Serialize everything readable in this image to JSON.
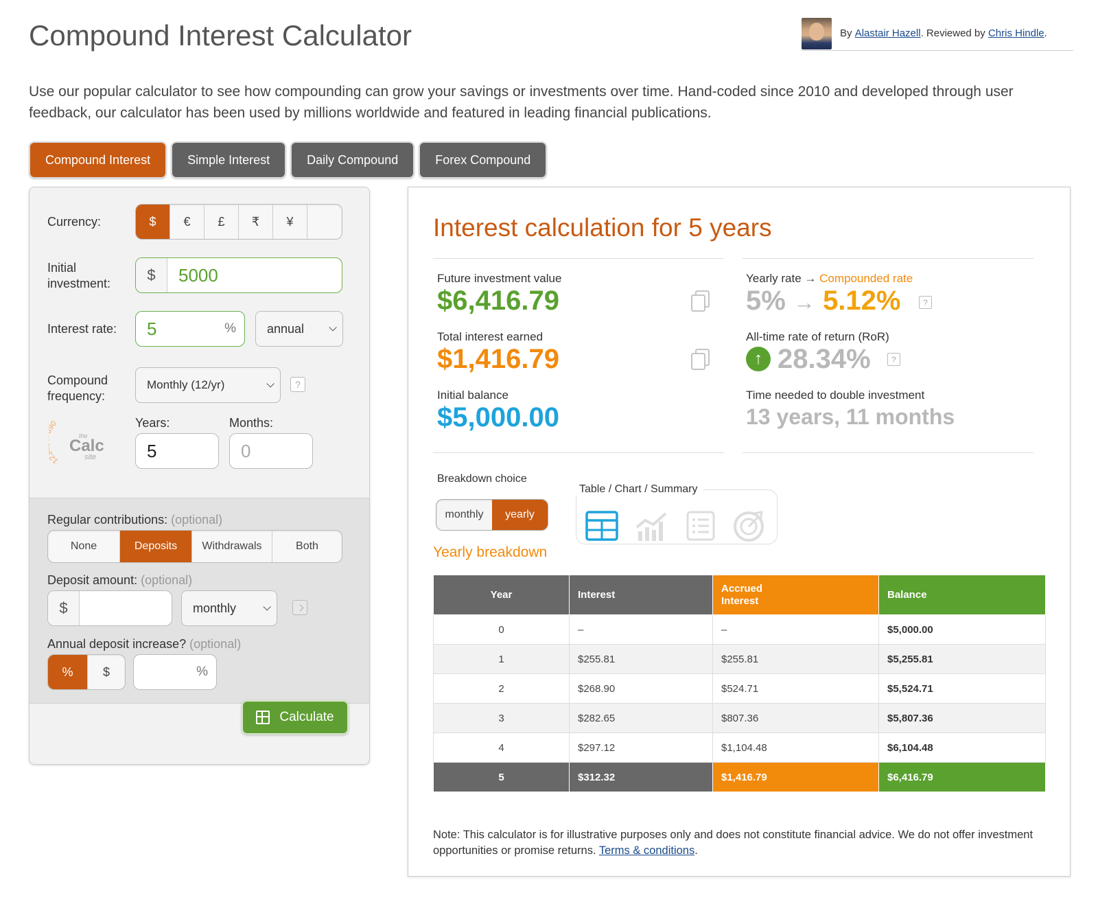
{
  "header": {
    "title": "Compound Interest Calculator",
    "by_label": "By",
    "author": "Alastair Hazell",
    "reviewed_label": ". Reviewed by",
    "reviewer": "Chris Hindle",
    "end": "."
  },
  "intro": "Use our popular calculator to see how compounding can grow your savings or investments over time. Hand-coded since 2010 and developed through user feedback, our calculator has been used by millions worldwide and featured in leading financial publications.",
  "tabs": [
    {
      "label": "Compound Interest",
      "active": true
    },
    {
      "label": "Simple Interest",
      "active": false
    },
    {
      "label": "Daily Compound",
      "active": false
    },
    {
      "label": "Forex Compound",
      "active": false
    }
  ],
  "form": {
    "currency_label": "Currency:",
    "currencies": [
      "$",
      "€",
      "£",
      "₹",
      "¥",
      ""
    ],
    "currency_selected": "$",
    "initial_label_1": "Initial",
    "initial_label_2": "investment:",
    "initial_prefix": "$",
    "initial_value": "5000",
    "rate_label": "Interest rate:",
    "rate_value": "5",
    "rate_suffix": "%",
    "rate_period": "annual",
    "freq_label_1": "Compound",
    "freq_label_2": "frequency:",
    "freq_value": "Monthly (12/yr)",
    "help": "?",
    "years_label": "Years:",
    "years_value": "5",
    "months_label": "Months:",
    "months_placeholder": "0",
    "logo_digits": "1234567890",
    "logo_the": "the",
    "logo_calc": "Calc",
    "logo_site": "site",
    "contrib_label": "Regular contributions:",
    "optional": "(optional)",
    "contrib_options": [
      "None",
      "Deposits",
      "Withdrawals",
      "Both"
    ],
    "contrib_selected": "Deposits",
    "deposit_label": "Deposit amount:",
    "deposit_prefix": "$",
    "deposit_value": "",
    "deposit_period": "monthly",
    "increase_label": "Annual deposit increase?",
    "increase_modes": [
      "%",
      "$"
    ],
    "increase_mode_selected": "%",
    "increase_suffix": "%",
    "calculate_label": "Calculate"
  },
  "results": {
    "title": "Interest calculation for 5 years",
    "future_label": "Future investment value",
    "future_value": "$6,416.79",
    "interest_label": "Total interest earned",
    "interest_value": "$1,416.79",
    "initial_label": "Initial balance",
    "initial_value": "$5,000.00",
    "rate_label_a": "Yearly rate →",
    "rate_label_b": "Compounded rate",
    "yearly_rate": "5%",
    "arrow": "→",
    "compounded_rate": "5.12%",
    "ror_label": "All-time rate of return (RoR)",
    "ror_value": "28.34%",
    "double_label": "Time needed to double investment",
    "double_value": "13 years, 11 months",
    "help": "?",
    "breakdown_label": "Breakdown choice",
    "breakdown_options": [
      "monthly",
      "yearly"
    ],
    "breakdown_selected": "yearly",
    "view_label": "Table / Chart / Summary",
    "yearly_title": "Yearly breakdown",
    "colors": {
      "accent": "#c85a12",
      "orange": "#f28a0c",
      "green": "#5aa12f",
      "blue": "#1ea3dc"
    }
  },
  "table": {
    "headers": {
      "year": "Year",
      "interest": "Interest",
      "accrued_1": "Accrued",
      "accrued_2": "Interest",
      "balance": "Balance"
    },
    "rows": [
      {
        "year": "0",
        "interest": "–",
        "accrued": "–",
        "balance": "$5,000.00"
      },
      {
        "year": "1",
        "interest": "$255.81",
        "accrued": "$255.81",
        "balance": "$5,255.81"
      },
      {
        "year": "2",
        "interest": "$268.90",
        "accrued": "$524.71",
        "balance": "$5,524.71"
      },
      {
        "year": "3",
        "interest": "$282.65",
        "accrued": "$807.36",
        "balance": "$5,807.36"
      },
      {
        "year": "4",
        "interest": "$297.12",
        "accrued": "$1,104.48",
        "balance": "$6,104.48"
      }
    ],
    "total": {
      "year": "5",
      "interest": "$312.32",
      "accrued": "$1,416.79",
      "balance": "$6,416.79"
    }
  },
  "note": {
    "text": "Note: This calculator is for illustrative purposes only and does not constitute financial advice. We do not offer investment opportunities or promise returns.",
    "link": "Terms & conditions",
    "end": "."
  }
}
